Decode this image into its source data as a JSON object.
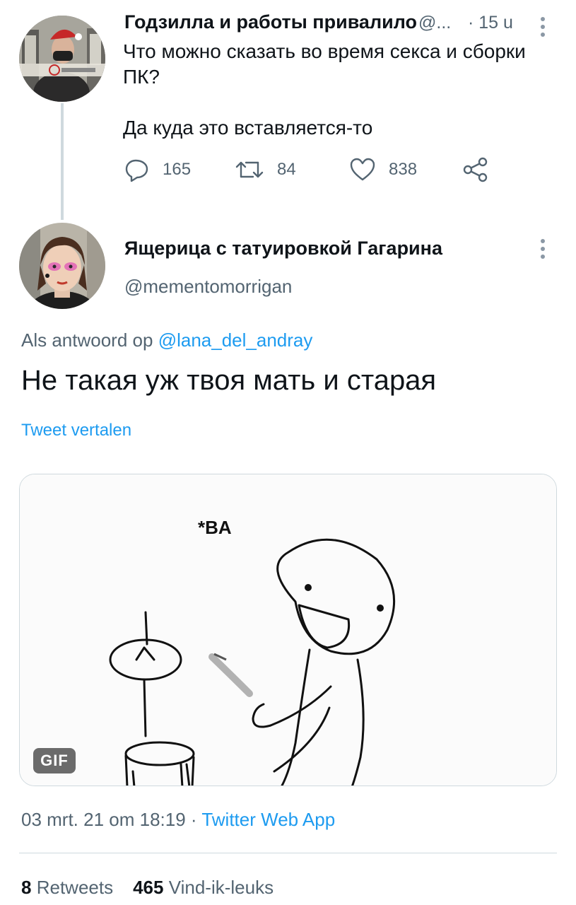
{
  "parent_tweet": {
    "author_name": "Годзилла и работы привалило",
    "handle": "@...",
    "time": "· 15 u",
    "text_line1": "Что можно сказать во время секса и сборки",
    "text_line2": "ПК?",
    "text_line3": "Да куда это вставляется-то",
    "replies": "165",
    "retweets": "84",
    "likes": "838",
    "icons": [
      "reply-icon",
      "retweet-icon",
      "like-icon",
      "share-icon"
    ]
  },
  "reply_tweet": {
    "author_name": "Ящерица с татуировкой Гагарина",
    "handle": "@mementomorrigan",
    "replying_prefix": "Als antwoord op",
    "replying_to": "@lana_del_andray",
    "text": "Не такая уж твоя мать и старая",
    "translate_label": "Tweet vertalen",
    "media": {
      "caption_text": "*BA",
      "badge": "GIF"
    },
    "timestamp": "03 mrt. 21 om 18:19 ·",
    "source": "Twitter Web App",
    "retweet_count": "8",
    "retweet_label": "Retweets",
    "like_count": "465",
    "like_label": "Vind-ik-leuks"
  },
  "colors": {
    "accent": "#1d9bf0",
    "secondary_text": "#536471",
    "primary_text": "#0f1419",
    "border": "#cfd9de"
  }
}
